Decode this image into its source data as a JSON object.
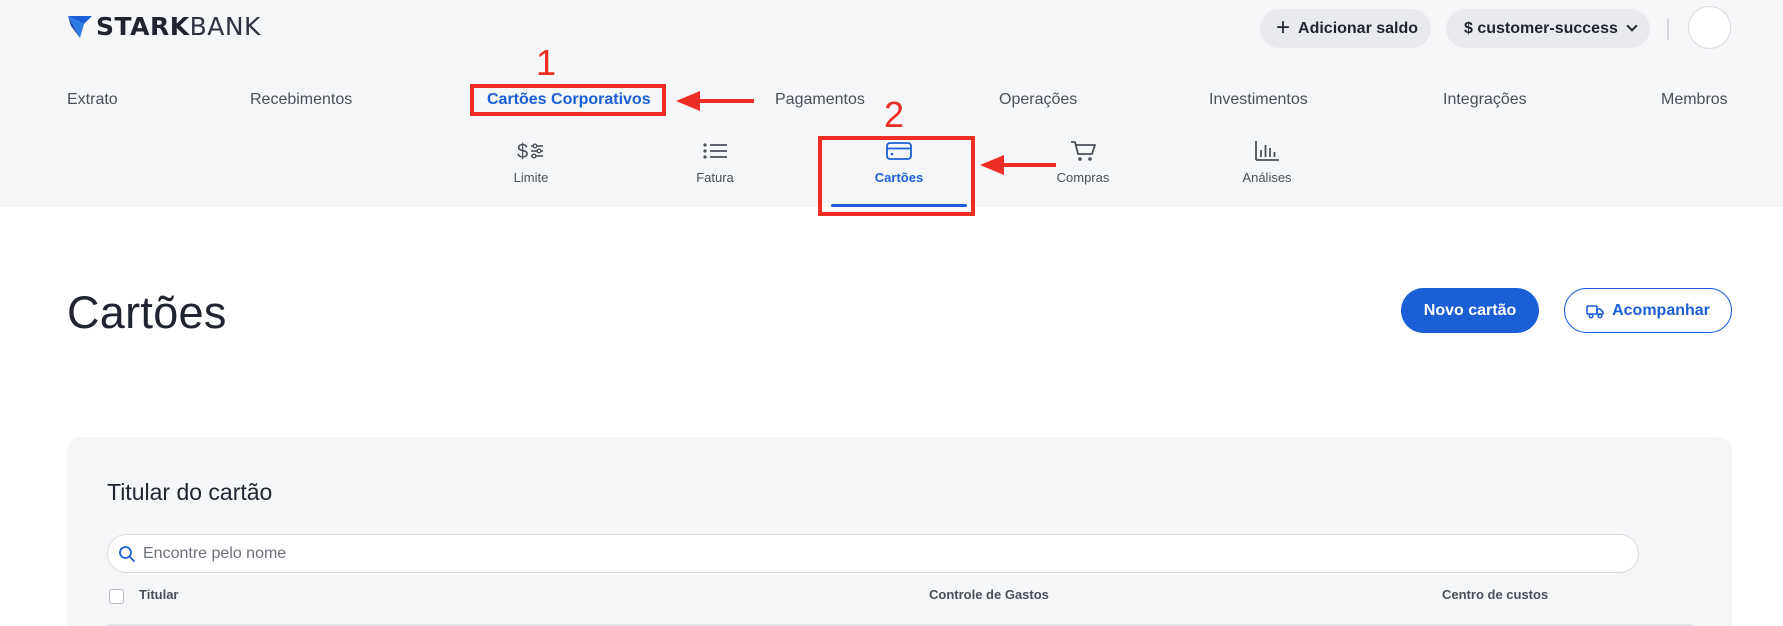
{
  "brand": {
    "name_bold": "STARK",
    "name_light": "BANK",
    "accent": "#1b5fd6"
  },
  "header": {
    "add_balance_label": "Adicionar saldo",
    "add_icon": "plus-icon",
    "workspace_label": "$ customer-success",
    "workspace_icon": "chevron-down-icon"
  },
  "main_nav": [
    {
      "label": "Extrato"
    },
    {
      "label": "Recebimentos"
    },
    {
      "label": "Cartões Corporativos",
      "active": true
    },
    {
      "label": "Pagamentos"
    },
    {
      "label": "Operações"
    },
    {
      "label": "Investimentos"
    },
    {
      "label": "Integrações"
    },
    {
      "label": "Membros"
    }
  ],
  "sub_nav": [
    {
      "label": "Limite",
      "icon": "limit-icon"
    },
    {
      "label": "Fatura",
      "icon": "list-icon"
    },
    {
      "label": "Cartões",
      "icon": "card-icon",
      "active": true
    },
    {
      "label": "Compras",
      "icon": "cart-icon"
    },
    {
      "label": "Análises",
      "icon": "bar-chart-icon"
    }
  ],
  "annotations": {
    "step1": "1",
    "step2": "2",
    "color": "#ee2e24"
  },
  "page": {
    "title": "Cartões",
    "new_card_label": "Novo cartão",
    "track_label": "Acompanhar",
    "track_icon": "truck-icon"
  },
  "filter": {
    "title": "Titular do cartão",
    "search_placeholder": "Encontre pelo nome",
    "search_icon": "search-icon"
  },
  "table": {
    "columns": [
      "Titular",
      "Controle de Gastos",
      "Centro de custos"
    ]
  }
}
